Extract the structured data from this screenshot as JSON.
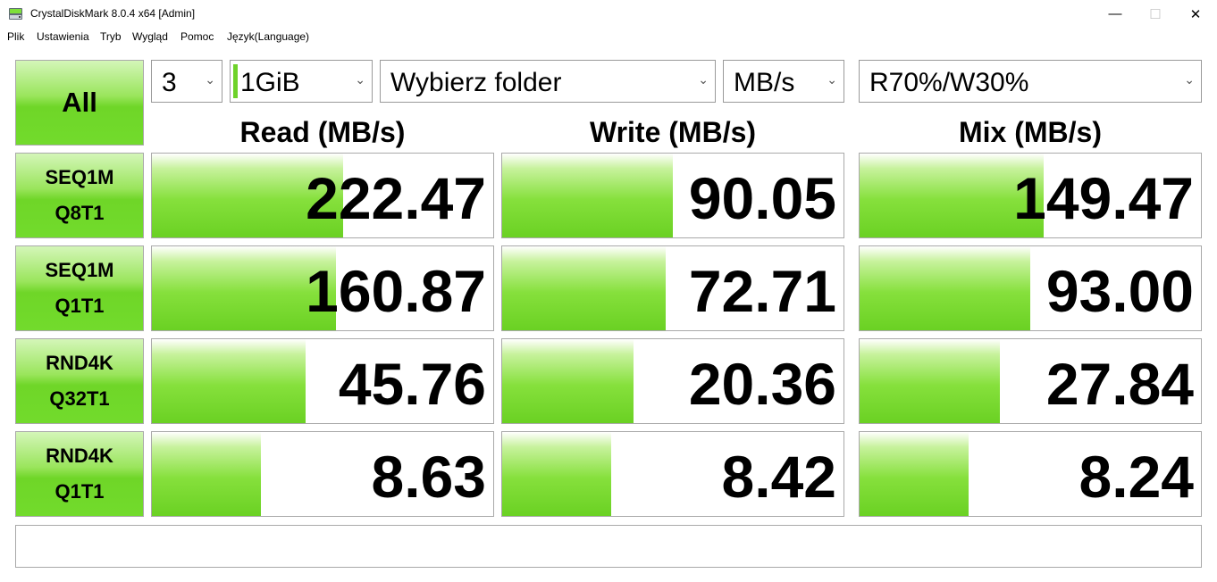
{
  "window": {
    "title": "CrystalDiskMark 8.0.4 x64 [Admin]",
    "controls": {
      "minimize": "—",
      "maximize": "☐",
      "close": "✕"
    }
  },
  "menu": [
    "Plik",
    "Ustawienia",
    "Tryb",
    "Wygląd",
    "Pomoc",
    "Język(Language)"
  ],
  "toolbar": {
    "all_label": "All",
    "count": "3",
    "size": "1GiB",
    "folder": "Wybierz folder",
    "unit": "MB/s",
    "mix": "R70%/W30%"
  },
  "headers": {
    "read": "Read (MB/s)",
    "write": "Write (MB/s)",
    "mix": "Mix (MB/s)"
  },
  "rows": [
    {
      "line1": "SEQ1M",
      "line2": "Q8T1",
      "read": "222.47",
      "read_fill": 0.56,
      "write": "90.05",
      "write_fill": 0.5,
      "mix": "149.47",
      "mix_fill": 0.54
    },
    {
      "line1": "SEQ1M",
      "line2": "Q1T1",
      "read": "160.87",
      "read_fill": 0.54,
      "write": "72.71",
      "write_fill": 0.48,
      "mix": "93.00",
      "mix_fill": 0.5
    },
    {
      "line1": "RND4K",
      "line2": "Q32T1",
      "read": "45.76",
      "read_fill": 0.45,
      "write": "20.36",
      "write_fill": 0.385,
      "mix": "27.84",
      "mix_fill": 0.41
    },
    {
      "line1": "RND4K",
      "line2": "Q1T1",
      "read": "8.63",
      "read_fill": 0.32,
      "write": "8.42",
      "write_fill": 0.32,
      "mix": "8.24",
      "mix_fill": 0.32
    }
  ],
  "status_text": ""
}
